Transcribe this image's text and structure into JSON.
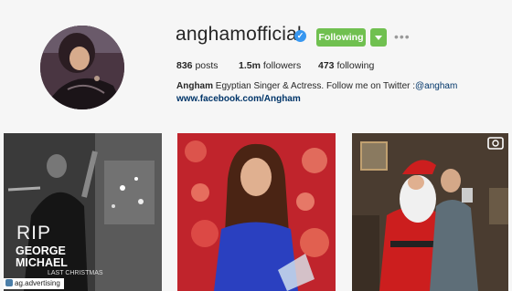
{
  "profile": {
    "username": "anghamofficial",
    "verified_mark": "✓",
    "follow_label": "Following",
    "more_label": "•••",
    "stats": {
      "posts_count": "836",
      "posts_label": "posts",
      "followers_count": "1.5m",
      "followers_label": "followers",
      "following_count": "473",
      "following_label": "following"
    },
    "bio": {
      "name": "Angham",
      "text": "Egyptian Singer & Actress. Follow me on Twitter :",
      "twitter": "@angham"
    },
    "link": "www.facebook.com/Angham",
    "accent_color": "#70c050",
    "verified_color": "#3897f0"
  },
  "posts": [
    {
      "overlay_rip": "RIP",
      "overlay_line1": "GEORGE",
      "overlay_line2": "MICHAEL",
      "overlay_line3": "LAST CHRISTMAS",
      "badge": "ag.advertising"
    },
    {},
    {
      "icon": "video-icon"
    }
  ]
}
